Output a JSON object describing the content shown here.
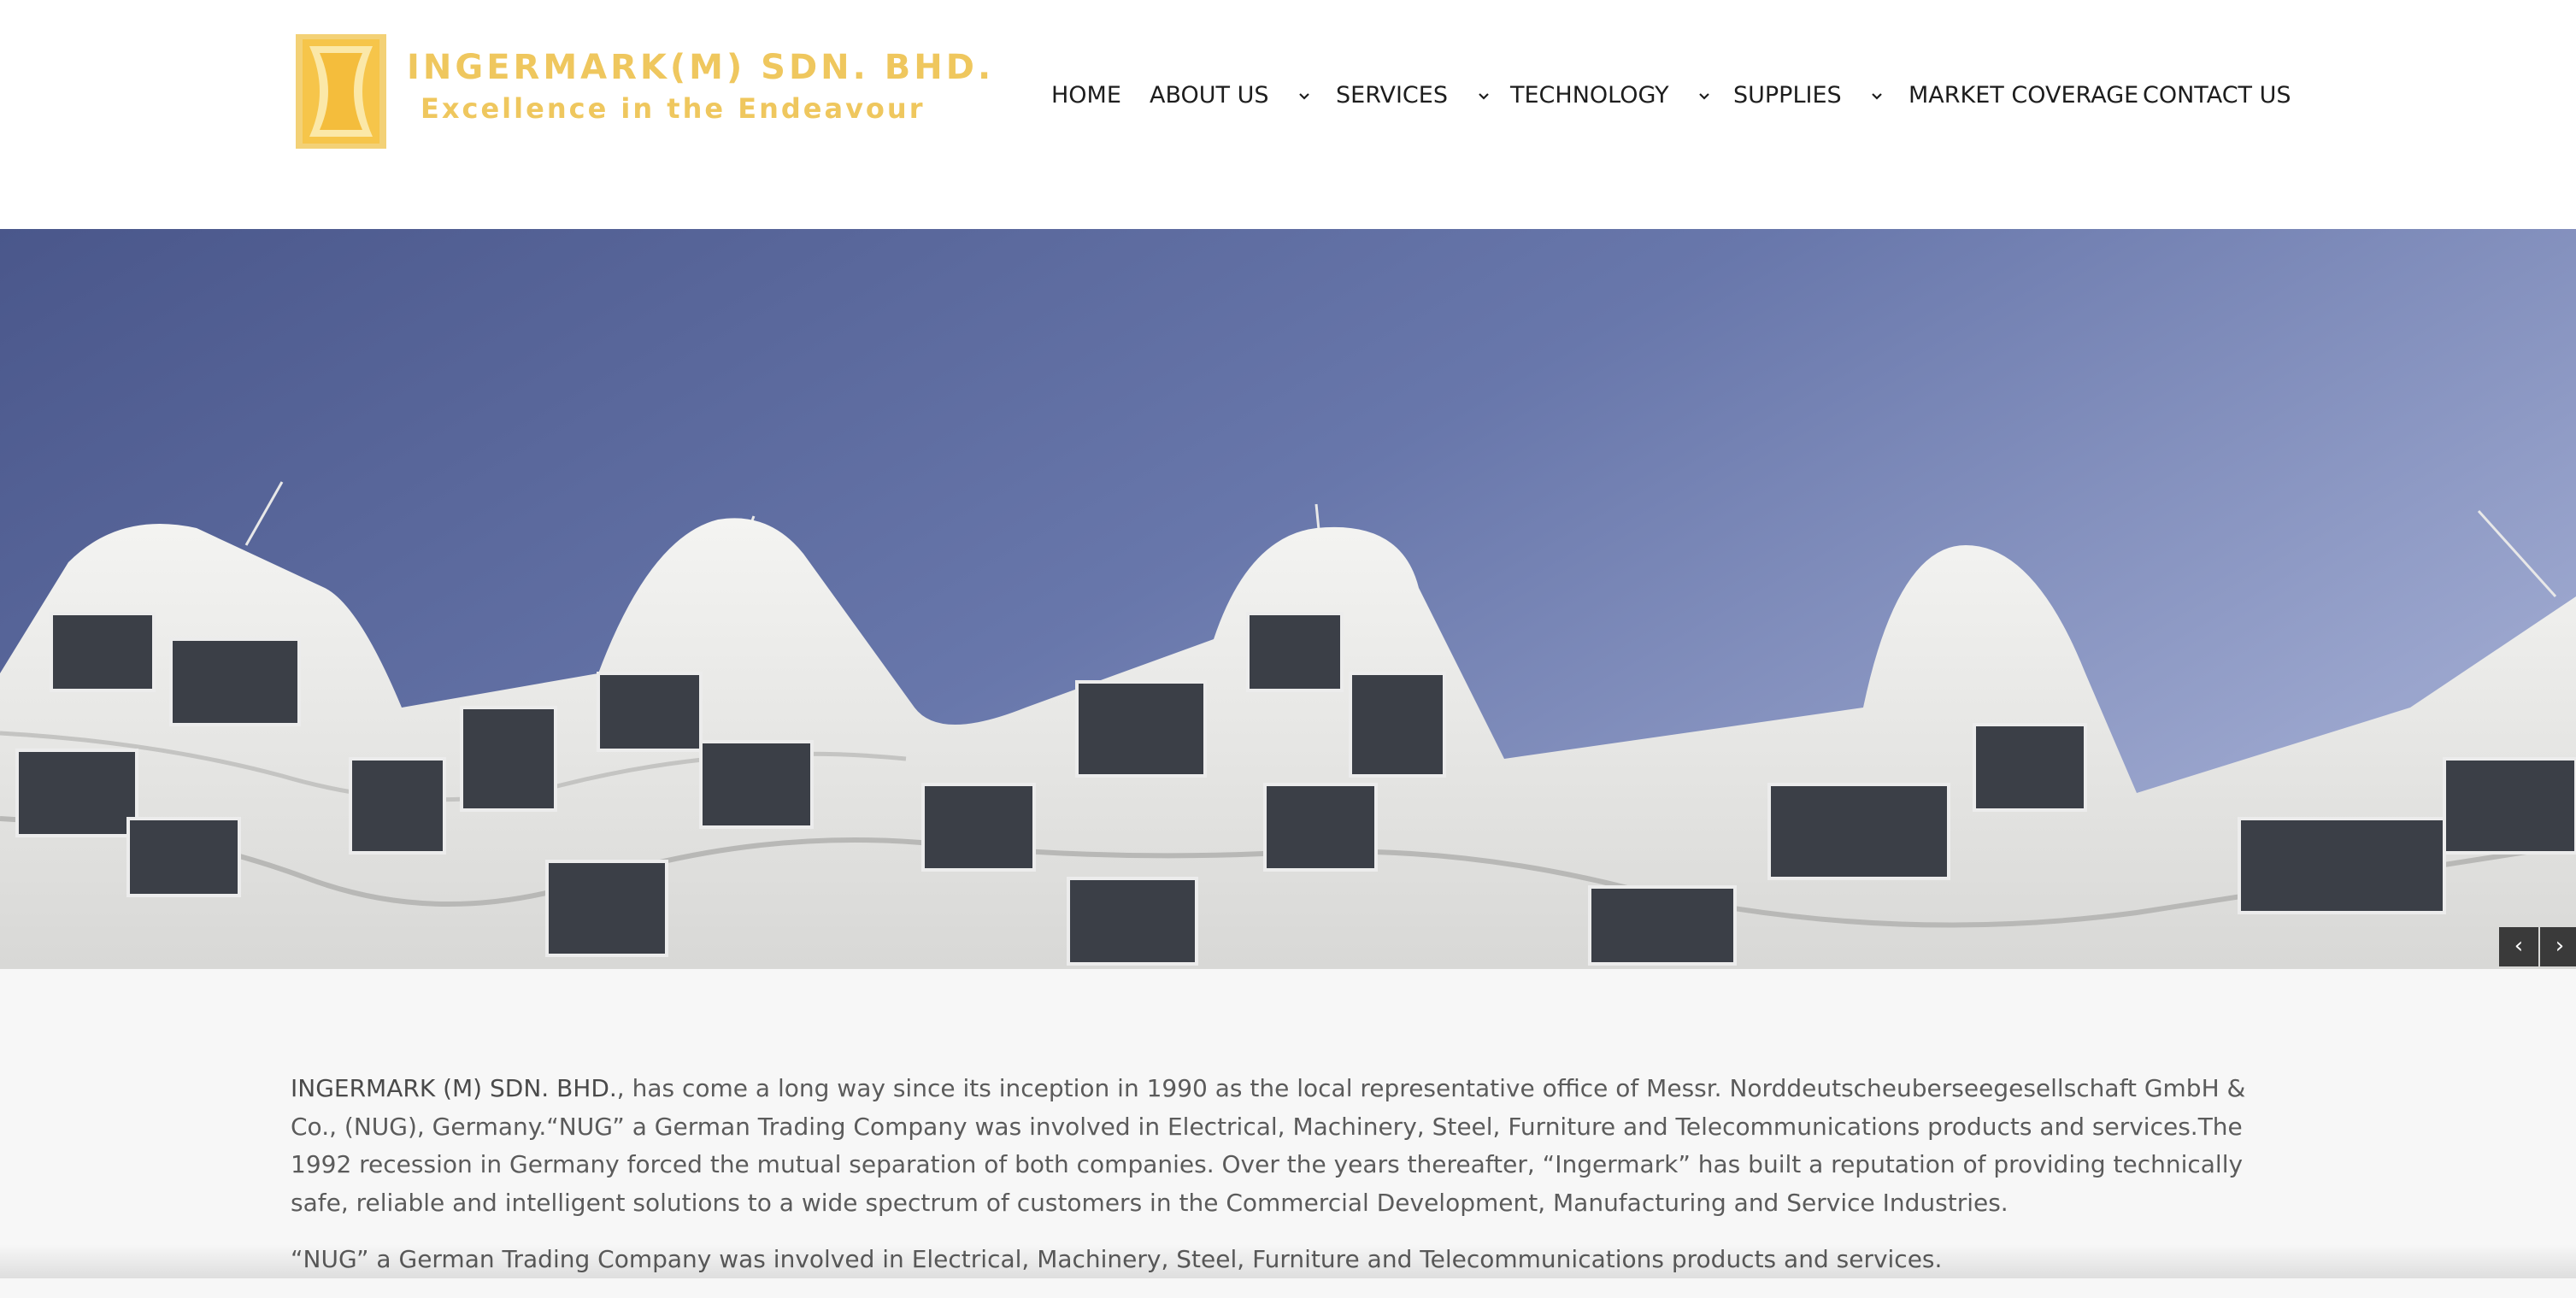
{
  "brand": {
    "name": "INGERMARK(M) SDN. BHD.",
    "tagline": "Excellence in the Endeavour",
    "color": "#efc75e"
  },
  "nav": {
    "items": [
      {
        "label": "HOME",
        "has_dropdown": false
      },
      {
        "label": "ABOUT US",
        "has_dropdown": true
      },
      {
        "label": "SERVICES",
        "has_dropdown": true
      },
      {
        "label": "TECHNOLOGY",
        "has_dropdown": true
      },
      {
        "label": "SUPPLIES",
        "has_dropdown": true
      },
      {
        "label": "MARKET COVERAGE",
        "has_dropdown": false
      },
      {
        "label": "CONTACT US",
        "has_dropdown": false
      }
    ],
    "dropdown_icon": "chevron-down-icon"
  },
  "hero": {
    "sky_color": "#6f7fb0",
    "prev_icon": "‹",
    "next_icon": "›"
  },
  "content": {
    "company_name": "INGERMARK (M) SDN. BHD.",
    "paragraph1_rest": ", has come a long way since its inception in 1990 as the local representative office of Messr. Norddeutscheuberseegesellschaft GmbH & Co., (NUG), Germany.“NUG” a German Trading Company was involved in Electrical, Machinery, Steel, Furniture and Telecommunications products and services.The 1992 recession in Germany forced the mutual separation of both companies. Over the years thereafter, “Ingermark” has built a reputation of providing technically safe, reliable and intelligent solutions to a wide spectrum of customers in the Commercial Development, Manufacturing and Service Industries.",
    "paragraph2": "“NUG” a German Trading Company was involved in Electrical, Machinery, Steel, Furniture and Telecommunications products and services."
  }
}
